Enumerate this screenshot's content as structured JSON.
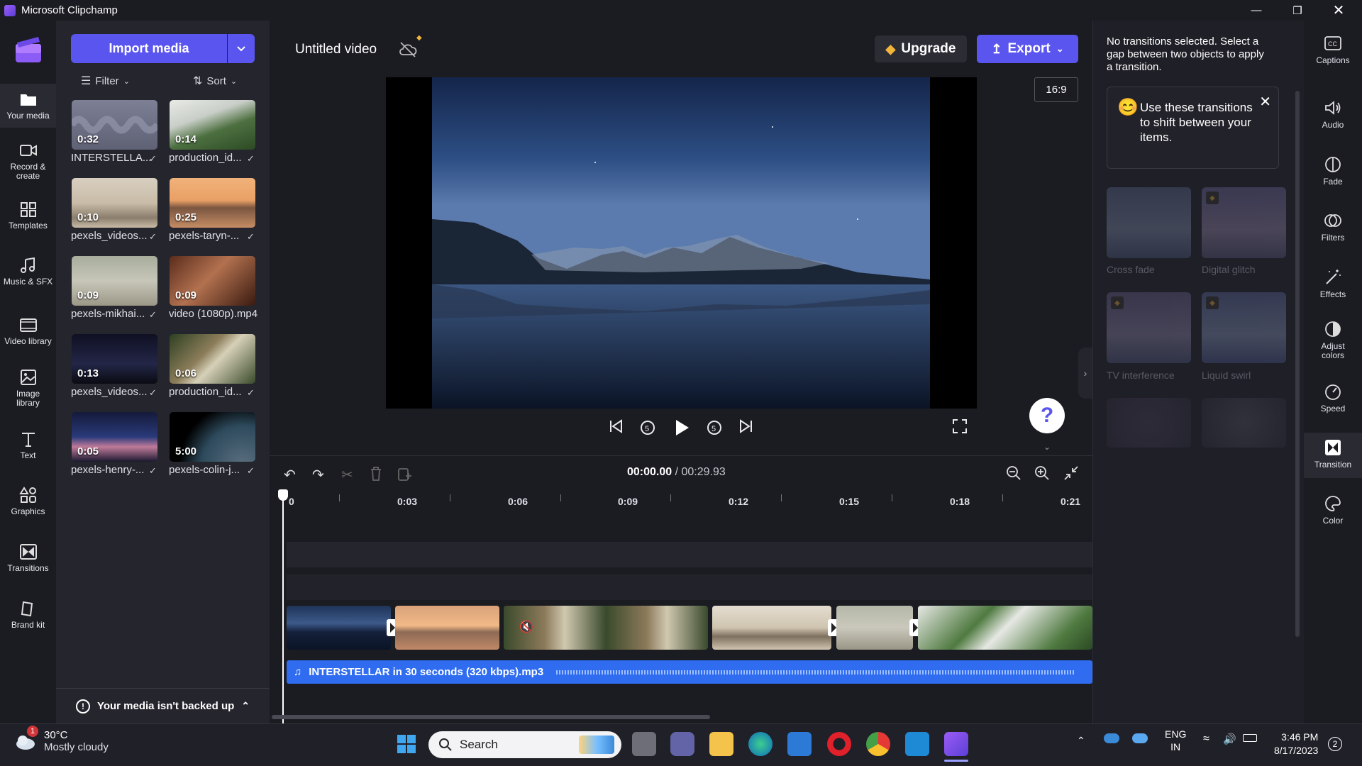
{
  "window": {
    "title": "Microsoft Clipchamp",
    "controls": [
      "minimize",
      "restore",
      "close"
    ]
  },
  "left_nav": [
    {
      "id": "your-media",
      "label": "Your media",
      "icon": "folder-icon",
      "active": true
    },
    {
      "id": "record-create",
      "label": "Record & create",
      "icon": "camera-icon",
      "active": false
    },
    {
      "id": "templates",
      "label": "Templates",
      "icon": "templates-icon",
      "active": false
    },
    {
      "id": "music-sfx",
      "label": "Music & SFX",
      "icon": "music-icon",
      "active": false
    },
    {
      "id": "video-library",
      "label": "Video library",
      "icon": "film-icon",
      "active": false
    },
    {
      "id": "image-library",
      "label": "Image library",
      "icon": "image-icon",
      "active": false
    },
    {
      "id": "text",
      "label": "Text",
      "icon": "text-icon",
      "active": false
    },
    {
      "id": "graphics",
      "label": "Graphics",
      "icon": "shapes-icon",
      "active": false
    },
    {
      "id": "transitions",
      "label": "Transitions",
      "icon": "transition-icon",
      "active": false
    },
    {
      "id": "brand-kit",
      "label": "Brand kit",
      "icon": "brand-icon",
      "active": false
    }
  ],
  "media_panel": {
    "import_label": "Import media",
    "filter_label": "Filter",
    "sort_label": "Sort",
    "items": [
      {
        "name": "INTERSTELLA...",
        "duration": "0:32",
        "thumb": "audio"
      },
      {
        "name": "production_id...",
        "duration": "0:14",
        "thumb": "mountain-fog"
      },
      {
        "name": "pexels_videos...",
        "duration": "0:10",
        "thumb": "seal"
      },
      {
        "name": "pexels-taryn-...",
        "duration": "0:25",
        "thumb": "sunset-beach"
      },
      {
        "name": "pexels-mikhai...",
        "duration": "0:09",
        "thumb": "birds"
      },
      {
        "name": "video (1080p).mp4",
        "duration": "0:09",
        "thumb": "woman"
      },
      {
        "name": "pexels_videos...",
        "duration": "0:13",
        "thumb": "night-sky"
      },
      {
        "name": "production_id...",
        "duration": "0:06",
        "thumb": "monkey"
      },
      {
        "name": "pexels-henry-...",
        "duration": "0:05",
        "thumb": "city"
      },
      {
        "name": "pexels-colin-j...",
        "duration": "5:00",
        "thumb": "earth"
      }
    ],
    "backup_text": "Your media isn't backed up"
  },
  "header": {
    "video_title": "Untitled video",
    "upgrade_label": "Upgrade",
    "export_label": "Export",
    "aspect_ratio": "16:9"
  },
  "timeline": {
    "current_time": "00:00.00",
    "total_time": " / 00:29.93",
    "ticks": [
      "0",
      "0:03",
      "0:06",
      "0:09",
      "0:12",
      "0:15",
      "0:18",
      "0:21"
    ],
    "audio_track_label": "INTERSTELLAR in 30 seconds (320 kbps).mp3"
  },
  "transition_panel": {
    "message": "No transitions selected. Select a gap between two objects to apply a transition.",
    "tip": "Use these transitions to shift between your items.",
    "transitions": [
      "Cross fade",
      "Digital glitch",
      "TV interference",
      "Liquid swirl"
    ]
  },
  "right_tools": [
    {
      "id": "captions",
      "label": "Captions",
      "icon": "captions-icon"
    },
    {
      "id": "audio",
      "label": "Audio",
      "icon": "speaker-icon"
    },
    {
      "id": "fade",
      "label": "Fade",
      "icon": "fade-icon"
    },
    {
      "id": "filters",
      "label": "Filters",
      "icon": "filters-icon"
    },
    {
      "id": "effects",
      "label": "Effects",
      "icon": "magic-wand-icon"
    },
    {
      "id": "adjust-colors",
      "label": "Adjust colors",
      "icon": "contrast-icon"
    },
    {
      "id": "speed",
      "label": "Speed",
      "icon": "speedometer-icon"
    },
    {
      "id": "transition",
      "label": "Transition",
      "icon": "transition-icon",
      "active": true
    },
    {
      "id": "color",
      "label": "Color",
      "icon": "palette-icon"
    }
  ],
  "taskbar": {
    "weather_badge": "1",
    "temperature": "30°C",
    "condition": "Mostly cloudy",
    "search_placeholder": "Search",
    "lang_top": "ENG",
    "lang_bottom": "IN",
    "time": "3:46 PM",
    "date": "8/17/2023",
    "notification_count": "2"
  },
  "colors": {
    "accent": "#5b55f0",
    "audio_track": "#2f6cf0",
    "background": "#1b1b22"
  }
}
